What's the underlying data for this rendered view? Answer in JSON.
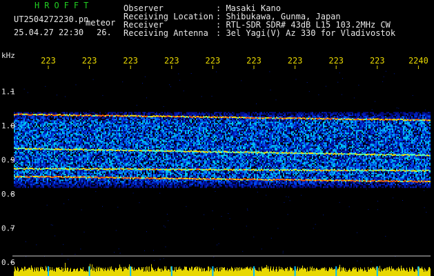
{
  "header": {
    "brand": "HROFFT",
    "filename": "UT2504272230.pn",
    "tag": "meteor",
    "datetime": "25.04.27 22:30",
    "extra": "26.",
    "labels": [
      "Observer",
      "Receiving Location",
      "Receiver",
      "Receiving Antenna"
    ],
    "values": [
      ": Masaki Kano",
      ": Shibukawa, Gunma, Japan",
      ": RTL-SDR SDR# 43dB L15 103.2MHz CW",
      ": 3el Yagi(V) Az 330 for Vladivostok"
    ]
  },
  "colors": {
    "background": "#000000",
    "text": "#e8e8e8",
    "brand": "#22cc22",
    "axis_labels": "#e8d800",
    "amplitude": "#e8d800",
    "markers": "#00bfff"
  },
  "chart_data": {
    "type": "heatmap",
    "ylabel": "kHz",
    "ylim": [
      0.6,
      1.17
    ],
    "yticks": [
      "1.1",
      "1.0",
      "0.9",
      "0.8",
      "0.7",
      "0.6"
    ],
    "yvalues": [
      1.1,
      1.0,
      0.9,
      0.8,
      0.7,
      0.6
    ],
    "xticks": [
      "223",
      "223",
      "223",
      "223",
      "223",
      "223",
      "223",
      "223",
      "223",
      "2240"
    ],
    "signal_region": [
      0.82,
      1.04
    ],
    "bands": [
      {
        "freq_start": 1.035,
        "freq_end": 1.018,
        "intensity": 0.95
      },
      {
        "freq_start": 0.935,
        "freq_end": 0.915,
        "intensity": 0.7
      },
      {
        "freq_start": 0.876,
        "freq_end": 0.87,
        "intensity": 0.75
      },
      {
        "freq_start": 0.853,
        "freq_end": 0.838,
        "intensity": 1.0
      }
    ],
    "amplitude_panel": true
  }
}
